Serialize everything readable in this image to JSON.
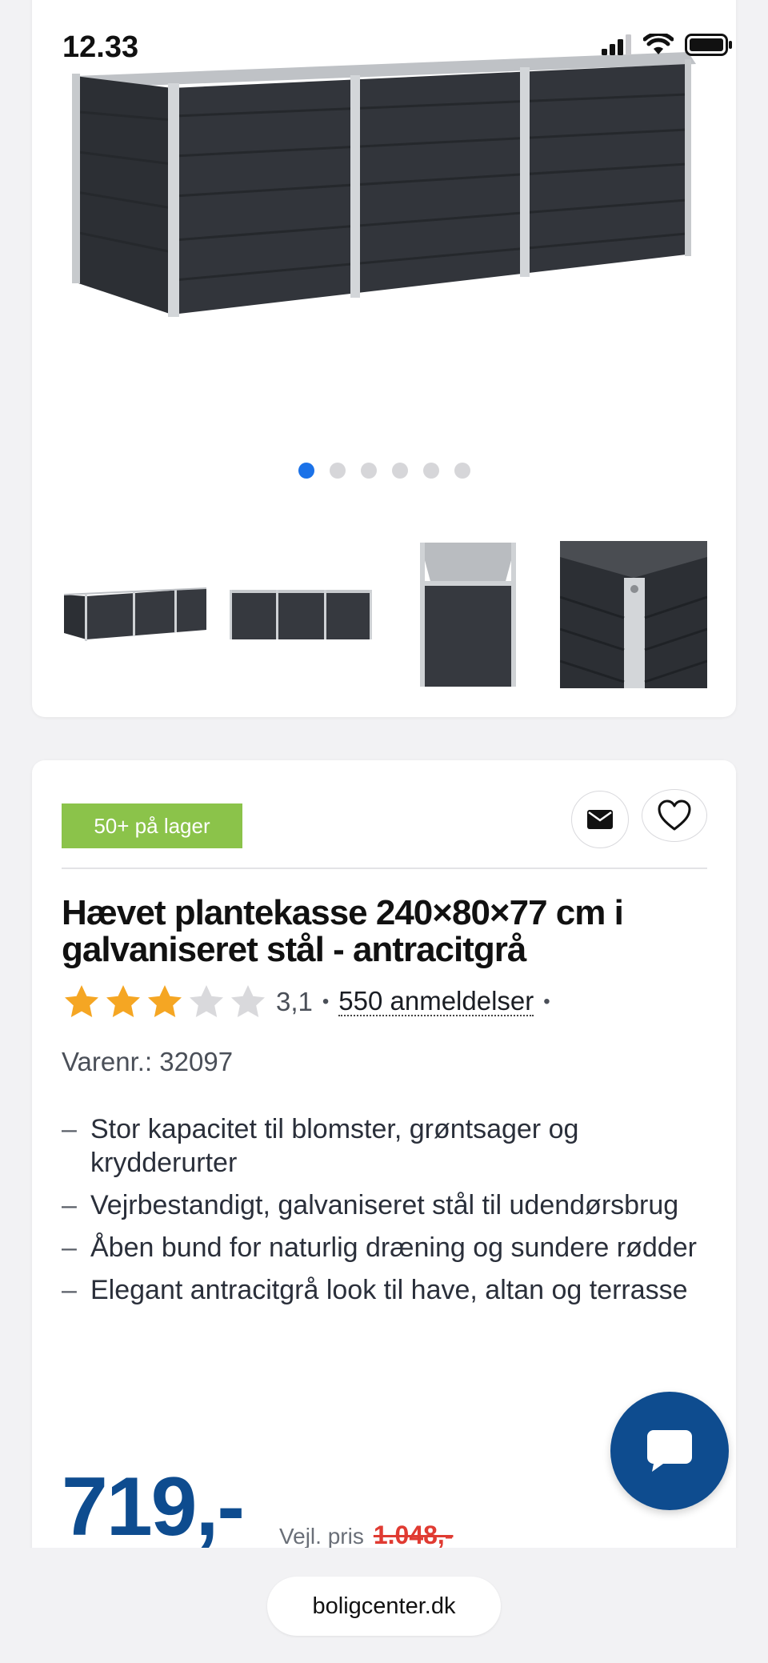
{
  "status_bar": {
    "time": "12.33"
  },
  "gallery": {
    "dots_total": 6,
    "active_index": 0,
    "colors": {
      "active_dot": "#1b72e8",
      "inactive_dot": "#d6d6d9"
    }
  },
  "product": {
    "stock_badge": "50+ på lager",
    "title": "Hævet plantekasse 240×80×77 cm i galvaniseret stål - antracitgrå",
    "rating": {
      "value": "3,1",
      "stars": 3.1,
      "max": 5,
      "sep": "•",
      "reviews_label": "550 anmeldelser"
    },
    "sku_label": "Varenr.:",
    "sku": "32097",
    "features": [
      "Stor kapacitet til blomster, grøntsager og krydderurter",
      "Vejrbestandigt, galvaniseret stål til udendørsbrug",
      "Åben bund for naturlig dræning og sundere rødder",
      "Elegant antracitgrå look til have, altan og terrasse"
    ],
    "price": "719,-",
    "rrp_label": "Vejl. pris",
    "rrp_value": "1.048,-",
    "colors": {
      "badge": "#8bc34a",
      "price": "#0e4c8f",
      "rrp": "#e03b32",
      "star_on": "#f5a623",
      "star_off": "#d9d9dc"
    }
  },
  "browser": {
    "url": "boligcenter.dk"
  }
}
